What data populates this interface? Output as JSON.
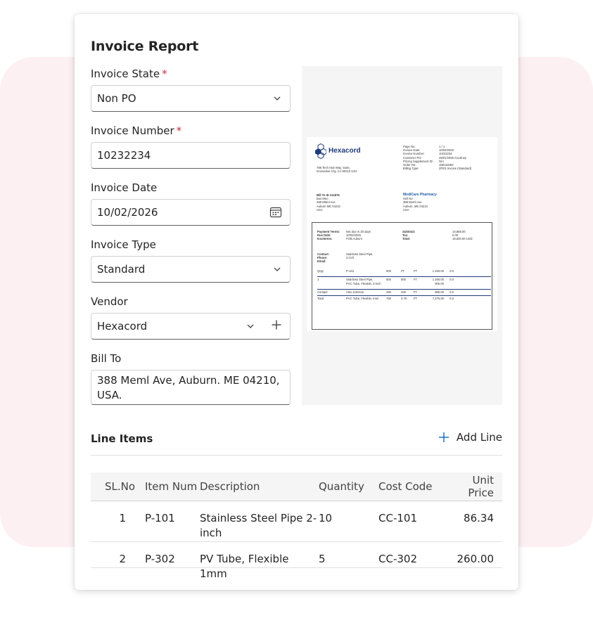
{
  "form": {
    "title": "Invoice Report",
    "invoice_state": {
      "label": "Invoice State",
      "required_mark": "*",
      "value": "Non PO"
    },
    "invoice_number": {
      "label": "Invoice Number",
      "required_mark": "*",
      "value": "10232234"
    },
    "invoice_date": {
      "label": "Invoice Date",
      "value": "10/02/2026"
    },
    "invoice_type": {
      "label": "Invoice Type",
      "value": "Standard"
    },
    "vendor": {
      "label": "Vendor",
      "value": "Hexacord"
    },
    "bill_to": {
      "label": "Bill To",
      "value": "388 Meml Ave, Auburn. ME 04210, USA."
    }
  },
  "preview_doc": {
    "logo_text": "Hexacord",
    "address": [
      "788 Tech Hub Way, Suite,",
      "Innovation City, CA 90210 USA"
    ],
    "meta": [
      [
        "Page No:",
        "1 / 1"
      ],
      [
        "Invoice Date:",
        "10/02/2026"
      ],
      [
        "Invoice Number:",
        "10232234"
      ],
      [
        "Customer PO:",
        "28/01/2026 Courtney"
      ],
      [
        "Pricing Supplement ID:",
        "N/A"
      ],
      [
        "Order No:",
        "188118482"
      ],
      [
        "Billing Type:",
        "ZFES Invoice (Standard)"
      ]
    ],
    "bill_to_id": "Bill To ID 211876",
    "bill_to_lines": [
      "Bus Mec:",
      "288 Mbrel Ave",
      "Auburn ME 04210",
      "USA"
    ],
    "ship_to_name": "MediCare Pharmacy",
    "ship_to_lines": [
      "Sell No:",
      "388 Meml Ave",
      "Auburn, ME 04210",
      "USA"
    ],
    "terms": [
      [
        "Payment Terms:",
        "Net due in 30 days",
        "Subtotal:",
        "10,868.00"
      ],
      [
        "Due Date:",
        "10/02/2026",
        "Tax:",
        "0.00"
      ],
      [
        "Incoterms:",
        "FOB Auburn",
        "Total:",
        "19,600.00 USD"
      ]
    ],
    "contact": [
      [
        "Contact:",
        "Stainless Steel Pipe,"
      ],
      [
        "Phone:",
        "2 inch"
      ],
      [
        "Email:",
        ""
      ]
    ],
    "table_rows": [
      [
        "Qqty",
        "P-101",
        "500",
        "FT",
        "FT",
        "1 250.00",
        "0.0"
      ],
      [
        "1",
        "Stainless Steel Pipe,",
        "500",
        "800",
        "FT",
        "1 260.00",
        "0.0"
      ],
      [
        "",
        "PVC Tube, Flexible, 2-inch",
        "",
        "",
        "",
        "900.00",
        ""
      ],
      [
        "Contact:",
        "Alex Johnson",
        "250",
        "200",
        "FT",
        "890.00",
        "0.0"
      ],
      [
        "Total:",
        "PVC Tube, Flexible, Imm",
        "750",
        "3.75",
        "FT",
        "7,375.00",
        "0.0"
      ]
    ]
  },
  "line_items": {
    "title": "Line Items",
    "add_label": "Add Line",
    "columns": [
      "SL.No",
      "Item Num",
      "Description",
      "Quantity",
      "Cost Code",
      "Unit Price"
    ],
    "rows": [
      {
        "sl": "1",
        "item": "P-101",
        "desc": "Stainless Steel Pipe 2-inch",
        "qty": "10",
        "cost": "CC-101",
        "price": "86.34"
      },
      {
        "sl": "2",
        "item": "P-302",
        "desc": "PV Tube, Flexible 1mm",
        "qty": "5",
        "cost": "CC-302",
        "price": "260.00"
      }
    ]
  },
  "colors": {
    "accent": "#0f6cbd",
    "required": "#c4314b",
    "background_blob": "#fdf0f2"
  }
}
